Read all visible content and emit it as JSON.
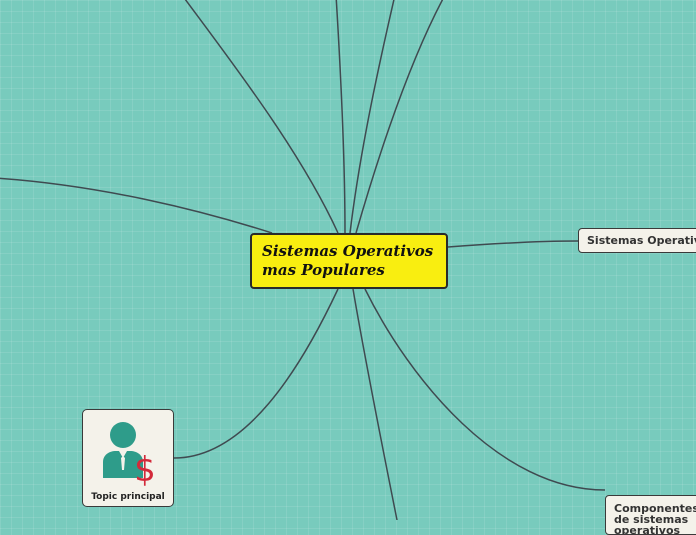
{
  "map": {
    "central_topic": "Sistemas Operativos mas Populares",
    "topics": {
      "sistemas_operativos": "Sistemas Operativos",
      "componentes": "Componentes de sistemas operativos"
    },
    "image_topic": {
      "label": "Topic principal",
      "icon": "businessman-dollar-icon",
      "dollar_symbol": "$"
    },
    "colors": {
      "background": "#78cbbd",
      "central_fill": "#f9ee10",
      "topic_fill": "#f4f2ea",
      "connector": "#3f4a50",
      "icon_person": "#2e9c8a",
      "icon_dollar": "#d32a3a"
    }
  }
}
